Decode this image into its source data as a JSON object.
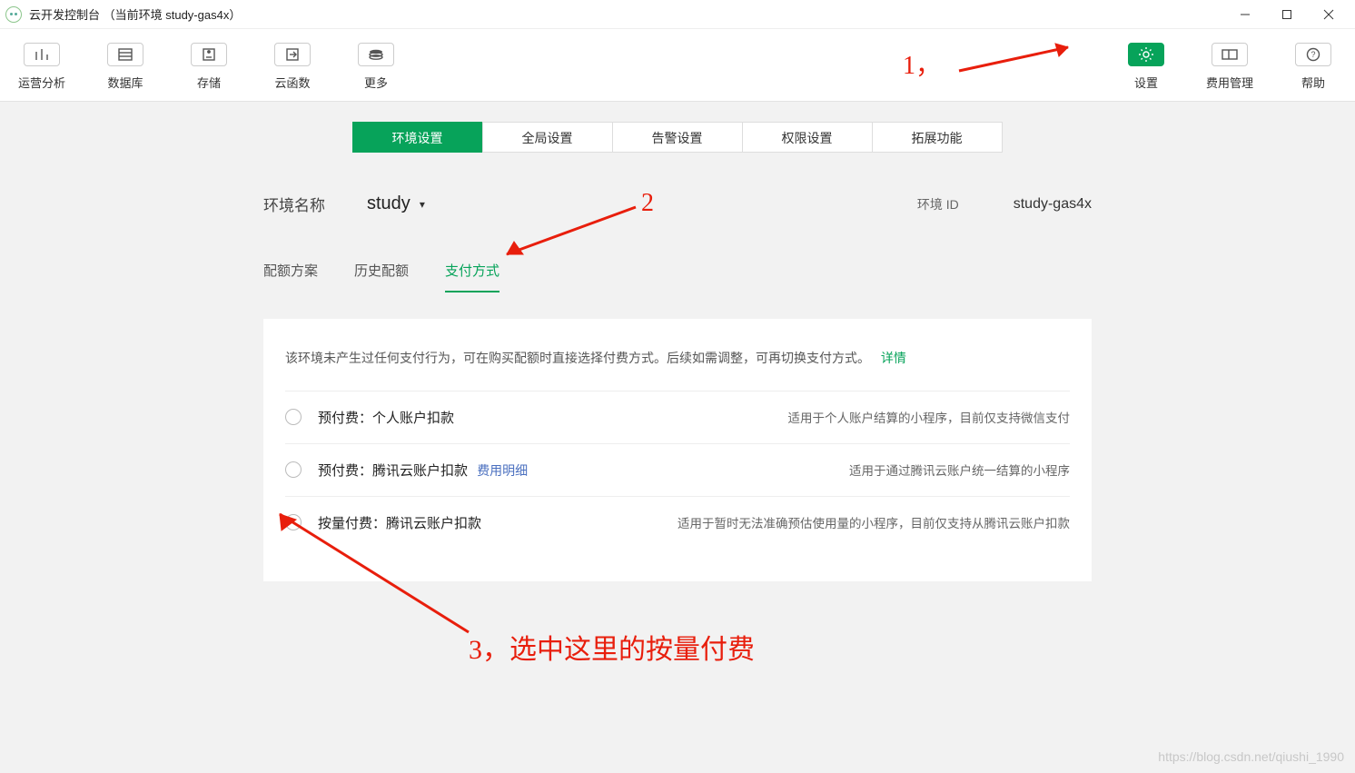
{
  "window": {
    "title": "云开发控制台 （当前环境 study-gas4x）"
  },
  "toolbar": {
    "analytics": "运营分析",
    "database": "数据库",
    "storage": "存储",
    "functions": "云函数",
    "more": "更多",
    "settings": "设置",
    "billing": "费用管理",
    "help": "帮助"
  },
  "tabs": {
    "env": "环境设置",
    "global": "全局设置",
    "alert": "告警设置",
    "perm": "权限设置",
    "ext": "拓展功能"
  },
  "env": {
    "name_label": "环境名称",
    "name_value": "study",
    "id_label": "环境 ID",
    "id_value": "study-gas4x"
  },
  "subtabs": {
    "quota": "配额方案",
    "history": "历史配额",
    "pay": "支付方式"
  },
  "panel": {
    "notice_text": "该环境未产生过任何支付行为，可在购买配额时直接选择付费方式。后续如需调整，可再切换支付方式。",
    "detail_link": "详情",
    "options": [
      {
        "title": "预付费：个人账户扣款",
        "desc": "适用于个人账户结算的小程序，目前仅支持微信支付"
      },
      {
        "title": "预付费：腾讯云账户扣款",
        "link": "费用明细",
        "desc": "适用于通过腾讯云账户统一结算的小程序"
      },
      {
        "title": "按量付费：腾讯云账户扣款",
        "desc": "适用于暂时无法准确预估使用量的小程序，目前仅支持从腾讯云账户扣款"
      }
    ]
  },
  "annotations": {
    "a1": "1，",
    "a2": "2",
    "a3": "3，选中这里的按量付费"
  },
  "watermark": "https://blog.csdn.net/qiushi_1990"
}
